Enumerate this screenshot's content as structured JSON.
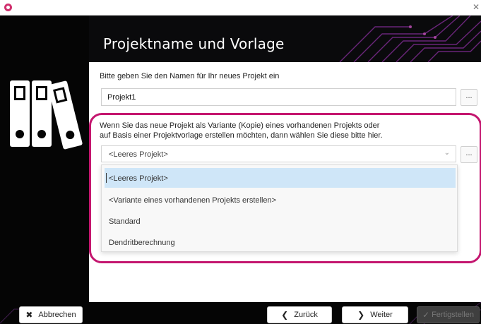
{
  "window": {
    "close_glyph": "✕"
  },
  "header": {
    "title": "Projektname und Vorlage"
  },
  "form": {
    "name_label": "Bitte geben Sie den Namen für Ihr neues Projekt ein",
    "name_value": "Projekt1",
    "browse_label": "...",
    "template_desc_line1": "Wenn Sie das neue Projekt als Variante (Kopie) eines vorhandenen Projekts oder",
    "template_desc_line2": "auf Basis einer Projektvorlage erstellen möchten, dann wählen Sie diese bitte hier.",
    "template_selected": "<Leeres Projekt>",
    "template_options": [
      "<Leeres Projekt>",
      "<Variante eines vorhandenen Projekts erstellen>",
      "Standard",
      "Dendritberechnung"
    ]
  },
  "footer": {
    "cancel_label": "Abbrechen",
    "back_label": "Zurück",
    "next_label": "Weiter",
    "finish_label": "Fertigstellen"
  },
  "colors": {
    "accent": "#c4166f",
    "selected_item": "#cfe6f8",
    "panel": "#050505"
  },
  "icons": [
    "app-logo-icon",
    "close-icon",
    "binders-icon",
    "chevron-down-icon",
    "cross-icon",
    "chevron-left-icon",
    "chevron-right-icon",
    "checkmark-icon"
  ]
}
